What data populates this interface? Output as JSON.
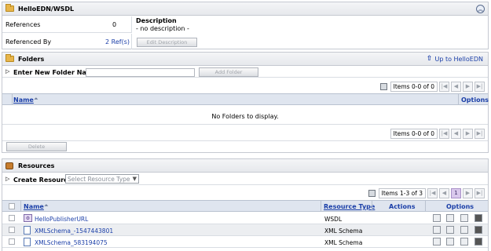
{
  "header": {
    "title": "HelloEDN/WSDL"
  },
  "info": {
    "references_label": "References",
    "references_value": "0",
    "referenced_by_label": "Referenced By",
    "referenced_by_value": "2 Ref(s)",
    "description_label": "Description",
    "description_value": "- no description -",
    "edit_description_button": "Edit Description"
  },
  "folders": {
    "title": "Folders",
    "up_link": "Up to HelloEDN",
    "enter_label": "Enter New Folder Name:",
    "add_button": "Add Folder",
    "items_label": "Items 0-0 of 0",
    "col_name": "Name",
    "col_options": "Options",
    "empty_text": "No Folders to display.",
    "delete_button": "Delete"
  },
  "resources": {
    "title": "Resources",
    "create_label": "Create Resource:",
    "select_placeholder": "Select Resource Type",
    "items_label": "Items 1-3 of 3",
    "current_page": "1",
    "col_name": "Name",
    "col_type": "Resource Type",
    "col_actions": "Actions",
    "col_options": "Options",
    "rows": [
      {
        "name": "HelloPublisherURL",
        "type": "WSDL"
      },
      {
        "name": "XMLSchema_-1547443801",
        "type": "XML Schema"
      },
      {
        "name": "XMLSchema_583194075",
        "type": "XML Schema"
      }
    ]
  },
  "colors": {
    "link": "#1b3fa8",
    "accent_page": "#d9c8ec",
    "header_bg": "#dfe5ef"
  }
}
